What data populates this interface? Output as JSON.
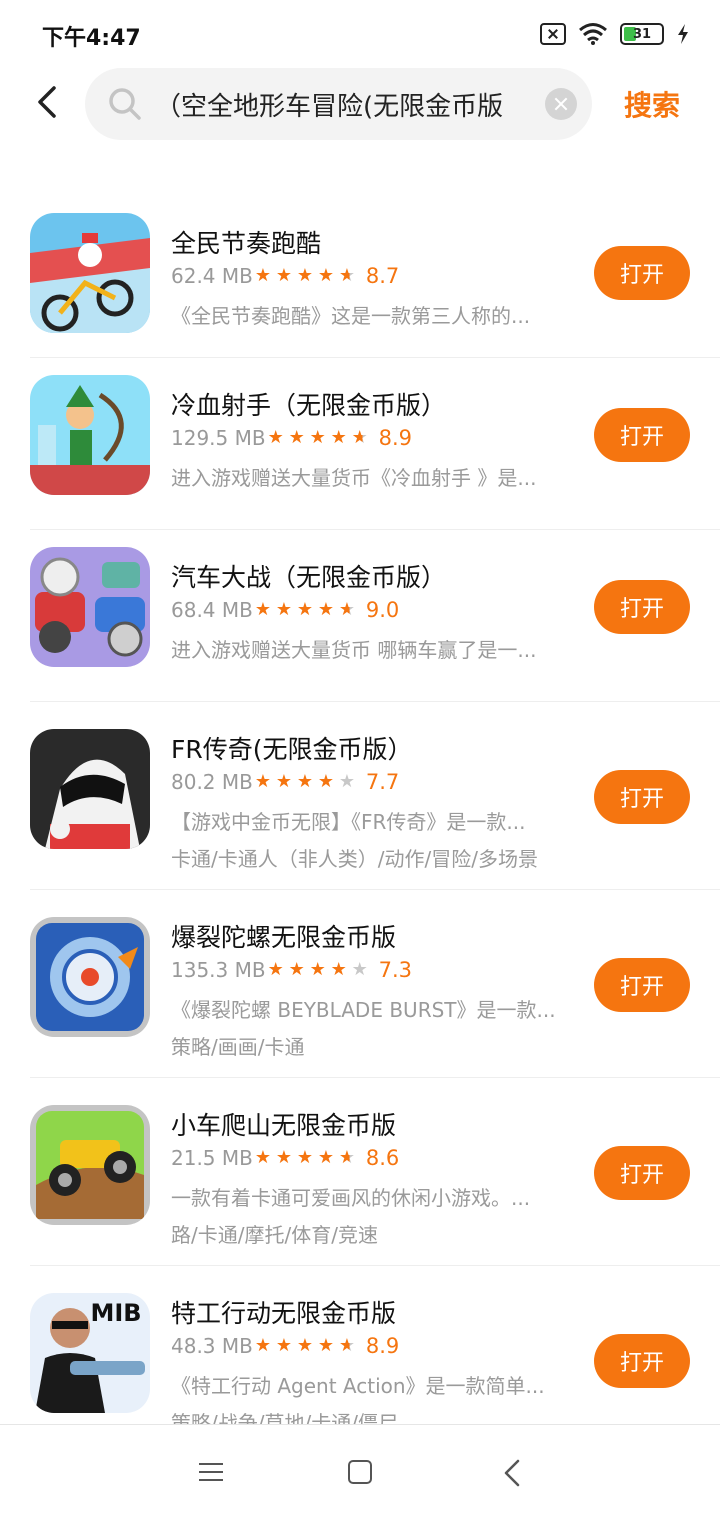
{
  "status_bar": {
    "time": "下午4:47",
    "battery": "31"
  },
  "search": {
    "query": "空全地形车冒险(无限金币版）",
    "button_label": "搜索"
  },
  "apps": [
    {
      "name": "全民节奏跑酷",
      "size": "62.4 MB",
      "stars": [
        "full",
        "full",
        "full",
        "full",
        "half"
      ],
      "rating": "8.7",
      "description": "《全民节奏跑酷》这是一款第三人称的...",
      "tags": "",
      "button": "打开",
      "icon": "bike-rider-icon",
      "icon_colors": [
        "#4aa8e8",
        "#e84a4a"
      ]
    },
    {
      "name": "冷血射手（无限金币版）",
      "size": "129.5 MB",
      "stars": [
        "full",
        "full",
        "full",
        "full",
        "half"
      ],
      "rating": "8.9",
      "description": "进入游戏赠送大量货币《冷血射手 》是...",
      "tags": "",
      "button": "打开",
      "icon": "archer-icon",
      "icon_colors": [
        "#7fd8f2",
        "#2e8b3a"
      ]
    },
    {
      "name": "汽车大战（无限金币版）",
      "size": "68.4 MB",
      "stars": [
        "full",
        "full",
        "full",
        "full",
        "half"
      ],
      "rating": "9.0",
      "description": "进入游戏赠送大量货币 哪辆车赢了是一...",
      "tags": "",
      "button": "打开",
      "icon": "battle-car-icon",
      "icon_colors": [
        "#8e7bd6",
        "#d83a3a"
      ]
    },
    {
      "name": "FR传奇(无限金币版）",
      "size": "80.2 MB",
      "stars": [
        "full",
        "full",
        "full",
        "full",
        "empty"
      ],
      "rating": "7.7",
      "description": "【游戏中金币无限】《FR传奇》是一款...",
      "tags": "卡通/卡通人（非人类）/动作/冒险/多场景",
      "button": "打开",
      "icon": "racer-helmet-icon",
      "icon_colors": [
        "#333333",
        "#ffffff"
      ]
    },
    {
      "name": "爆裂陀螺无限金币版",
      "size": "135.3 MB",
      "stars": [
        "full",
        "full",
        "full",
        "full",
        "empty"
      ],
      "rating": "7.3",
      "description": "《爆裂陀螺 BEYBLADE BURST》是一款...",
      "tags": "策略/画画/卡通",
      "button": "打开",
      "icon": "spinning-top-icon",
      "icon_colors": [
        "#2a5fb8",
        "#9fc6ee"
      ]
    },
    {
      "name": "小车爬山无限金币版",
      "size": "21.5 MB",
      "stars": [
        "full",
        "full",
        "full",
        "full",
        "half"
      ],
      "rating": "8.6",
      "description": "一款有着卡通可爱画风的休闲小游戏。...",
      "tags": "路/卡通/摩托/体育/竞速",
      "button": "打开",
      "icon": "hill-car-icon",
      "icon_colors": [
        "#8fd64a",
        "#f2c21a"
      ]
    },
    {
      "name": "特工行动无限金币版",
      "size": "48.3 MB",
      "stars": [
        "full",
        "full",
        "full",
        "full",
        "half"
      ],
      "rating": "8.9",
      "description": "《特工行动 Agent Action》是一款简单...",
      "tags": "策略/战争/草地/卡通/僵尸",
      "button": "打开",
      "icon": "mib-agent-icon",
      "icon_colors": [
        "#1f3f8a",
        "#e8f0fa"
      ],
      "icon_text": "MIB"
    }
  ],
  "nav": {
    "menu": "menu-icon",
    "home": "home-icon",
    "back": "back-icon"
  }
}
